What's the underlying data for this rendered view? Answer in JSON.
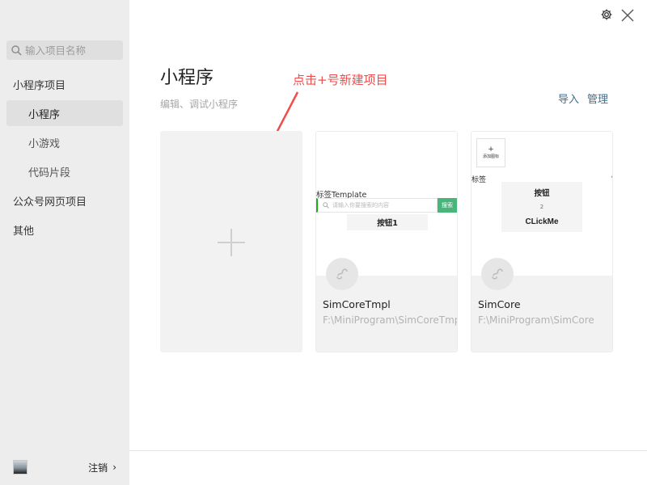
{
  "sidebar": {
    "search_placeholder": "输入项目名称",
    "items": [
      {
        "label": "小程序项目",
        "type": "category"
      },
      {
        "label": "小程序",
        "type": "sub",
        "active": true
      },
      {
        "label": "小游戏",
        "type": "sub"
      },
      {
        "label": "代码片段",
        "type": "sub"
      },
      {
        "label": "公众号网页项目",
        "type": "category"
      },
      {
        "label": "其他",
        "type": "category"
      }
    ],
    "logout_label": "注销"
  },
  "header": {
    "title": "小程序",
    "subtitle": "编辑、调试小程序",
    "import_label": "导入",
    "manage_label": "管理"
  },
  "annotation": {
    "text": "点击+号新建项目",
    "color": "#f24b4b"
  },
  "projects": [
    {
      "name": "SimCoreTmpl",
      "path": "F:\\MiniProgram\\SimCoreTmpl",
      "preview": {
        "label": "标签Template",
        "search_placeholder": "请输入你要搜索的内容",
        "search_button": "搜索",
        "button": "按钮1"
      }
    },
    {
      "name": "SimCore",
      "path": "F:\\MiniProgram\\SimCore",
      "preview": {
        "add_text": "添加图标",
        "label": "标签",
        "button": "按钮",
        "number": "2",
        "click": "CLickMe"
      }
    }
  ],
  "colors": {
    "sidebar_bg": "#ededed",
    "accent_link": "#3d6e90",
    "green": "#48b67b"
  }
}
